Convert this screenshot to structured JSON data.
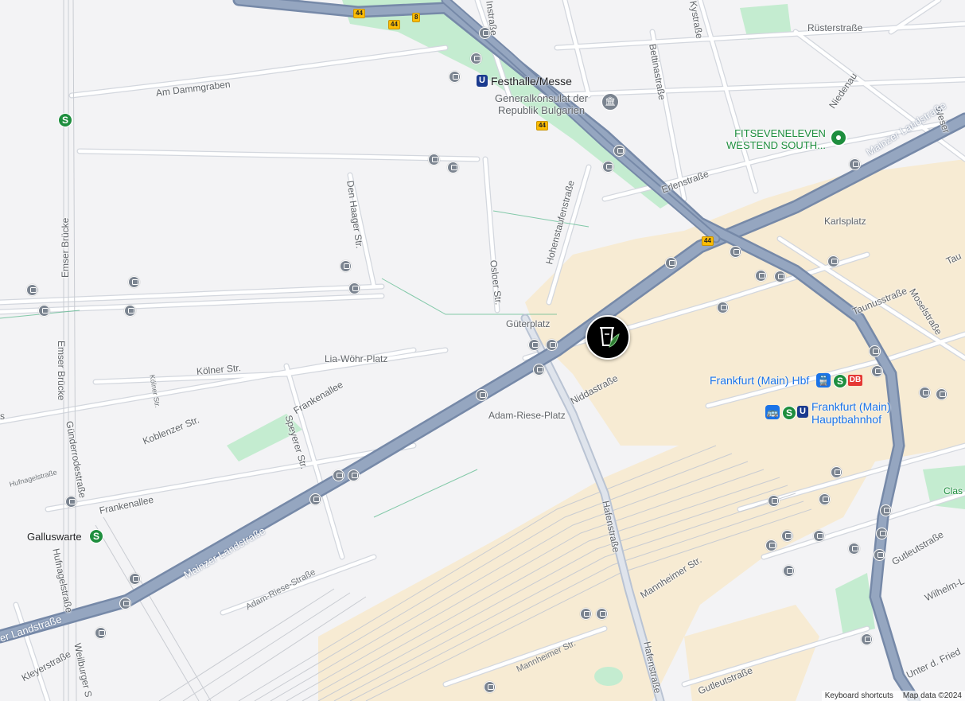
{
  "streets": {
    "mainzer_landstrasse_upper": "Mainzer Landstraße",
    "mainzer_landstrasse_lower": "Mainzer Landstraße",
    "mainzer_landstrasse_edge": "er Landstraße",
    "am_dammgraben": "Am Dammgraben",
    "den_haager_str": "Den Haager Str.",
    "osloer_str": "Osloer Str.",
    "hohenstaufenstrasse": "Hohenstaufenstraße",
    "bettinastrasse": "Bettinastraße",
    "ruesterstrasse": "Rüsterstraße",
    "niedenau": "Niedenau",
    "erlenstrasse": "Erlenstraße",
    "kystrasse": "Kystraße",
    "instrasse": "Instraße",
    "weserstr_edge": "Weser",
    "taunusstrasse": "Taunusstraße",
    "moselstrasse": "Moselstraße",
    "taunus_edge": "Tau",
    "emser_bruecke_top": "Emser Brücke",
    "emser_bruecke_bottom": "Emser Brücke",
    "koelner_str": "Kölner Str.",
    "koelner_str_small": "Kölner Str.",
    "koblenzer_str": "Koblenzer Str.",
    "frankenallee_upper": "Frankenallee",
    "frankenallee_lower": "Frankenallee",
    "speyerer_str": "Speyerer Str.",
    "guenderrodestrasse": "Günderrodestraße",
    "hufnagelstrasse": "Hufnagelstraße",
    "hufnagelstrasse_small": "Hufnagelstraße",
    "kleyerstrasse": "Kleyerstraße",
    "weilburger": "Weilburger S",
    "adam_riese_strasse": "Adam-Riese-Straße",
    "niddastrasse": "Niddastraße",
    "hafenstrasse_upper": "Hafenstraße",
    "hafenstrasse_lower": "Hafenstraße",
    "mannheimer_str_upper": "Mannheimer Str.",
    "mannheimer_str_lower": "Mannheimer Str.",
    "gutleutstrasse_right": "Gutleutstraße",
    "gutleutstrasse_bottom": "Gutleutstraße",
    "wilhelm": "Wilhelm-L",
    "unter_d_fried": "Unter d. Fried",
    "str_edge": "s",
    "clas": "Clas"
  },
  "places": {
    "gueterplatz": "Güterplatz",
    "adam_riese_platz": "Adam-Riese-Platz",
    "lia_woehr_platz": "Lia-Wöhr-Platz",
    "karlsplatz": "Karlsplatz",
    "galluswarte": "Galluswarte",
    "festhalle_messe": "Festhalle/Messe",
    "generalkonsulat": [
      "Generalkonsulat der",
      "Republik Bulgarien"
    ],
    "fitseveneleven": [
      "FITSEVENELEVEN",
      "WESTEND SOUTH..."
    ],
    "frankfurt_hbf": "Frankfurt (Main) Hbf",
    "frankfurt_hauptbahnhof": [
      "Frankfurt (Main)",
      "Hauptbahnhof"
    ]
  },
  "route_shields": [
    "44",
    "44",
    "8",
    "44",
    "44"
  ],
  "transit_badges": {
    "sbahn": "S",
    "ubahn": "U",
    "db": "DB"
  },
  "footer": {
    "keyboard_shortcuts": "Keyboard shortcuts",
    "map_data": "Map data ©2024"
  },
  "colors": {
    "highway": "#8a9bb8",
    "road": "#ffffff",
    "road_edge": "#d3d7de",
    "park": "#c4ecd0",
    "station_area": "#f7ebd3",
    "rail": "#c9ccd2",
    "background": "#f3f3f5"
  }
}
